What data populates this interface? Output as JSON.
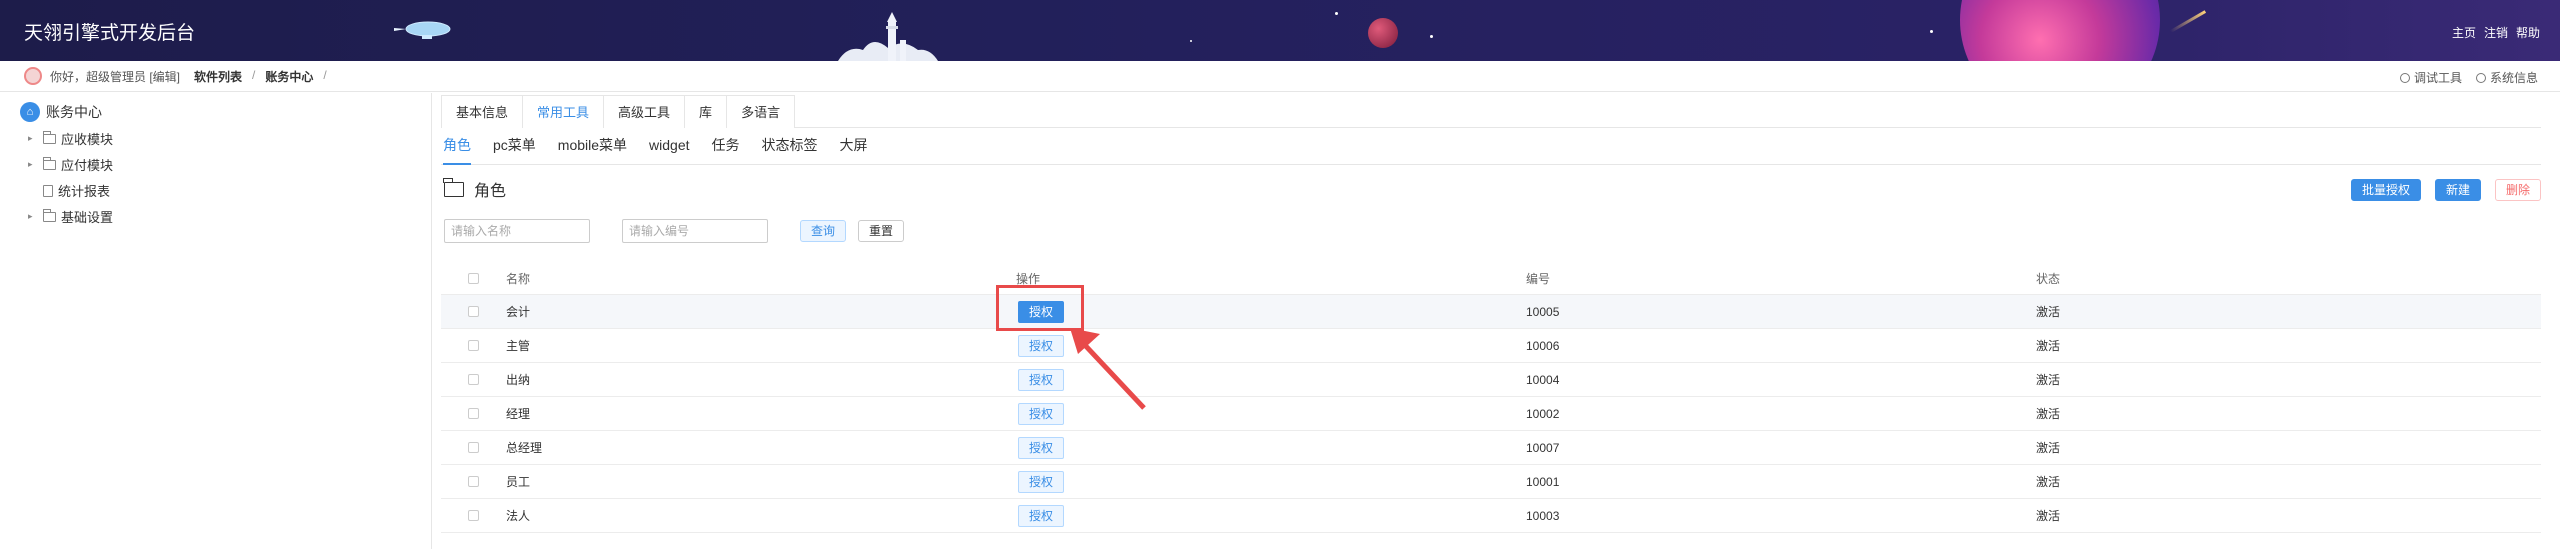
{
  "header": {
    "title": "天翎引擎式开发后台",
    "nav": [
      "主页",
      "注销",
      "帮助"
    ]
  },
  "breadcrumb": {
    "greeting": "你好，超级管理员 [编辑]",
    "items": [
      "软件列表",
      "账务中心"
    ],
    "separator": "/"
  },
  "tools": {
    "debug": "调试工具",
    "sysinfo": "系统信息"
  },
  "sidebar": {
    "root": "账务中心",
    "items": [
      {
        "label": "应收模块",
        "type": "folder",
        "expandable": true
      },
      {
        "label": "应付模块",
        "type": "folder",
        "expandable": true
      },
      {
        "label": "统计报表",
        "type": "doc",
        "expandable": false
      },
      {
        "label": "基础设置",
        "type": "folder",
        "expandable": true
      }
    ]
  },
  "tabs_primary": [
    "基本信息",
    "常用工具",
    "高级工具",
    "库",
    "多语言"
  ],
  "tabs_primary_active": 1,
  "tabs_secondary": [
    "角色",
    "pc菜单",
    "mobile菜单",
    "widget",
    "任务",
    "状态标签",
    "大屏"
  ],
  "tabs_secondary_active": 0,
  "panel": {
    "title": "角色",
    "batch_auth": "批量授权",
    "create": "新建",
    "delete": "删除"
  },
  "search": {
    "name_placeholder": "请输入名称",
    "code_placeholder": "请输入编号",
    "query": "查询",
    "reset": "重置"
  },
  "table": {
    "columns": [
      "名称",
      "操作",
      "编号",
      "状态"
    ],
    "action_label": "授权",
    "rows": [
      {
        "name": "会计",
        "code": "10005",
        "status": "激活"
      },
      {
        "name": "主管",
        "code": "10006",
        "status": "激活"
      },
      {
        "name": "出纳",
        "code": "10004",
        "status": "激活"
      },
      {
        "name": "经理",
        "code": "10002",
        "status": "激活"
      },
      {
        "name": "总经理",
        "code": "10007",
        "status": "激活"
      },
      {
        "name": "员工",
        "code": "10001",
        "status": "激活"
      },
      {
        "name": "法人",
        "code": "10003",
        "status": "激活"
      }
    ]
  },
  "colors": {
    "accent": "#3a8ee6",
    "annotation": "#e84a4a",
    "header_bg": "#1d1c4a"
  },
  "icons": [
    "home-icon",
    "folder-icon",
    "document-icon",
    "caret-right-icon",
    "debug-tool-icon",
    "system-info-icon",
    "avatar-icon"
  ]
}
